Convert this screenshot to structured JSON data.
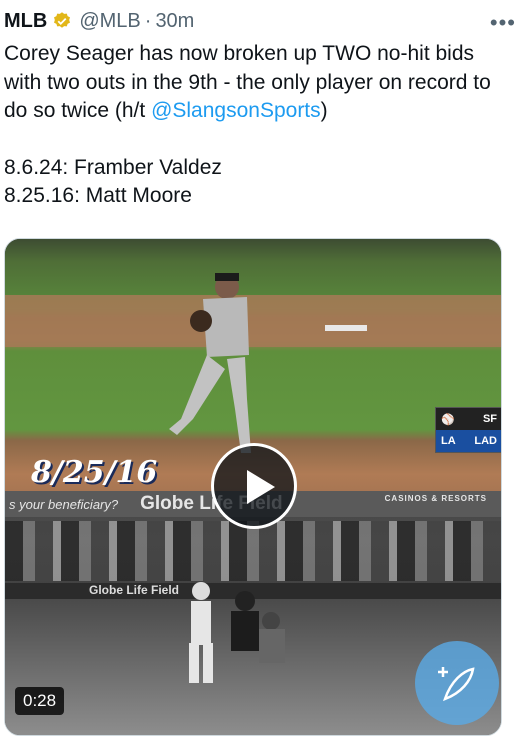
{
  "tweet": {
    "author_name": "MLB",
    "handle": "@MLB",
    "separator": "·",
    "time": "30m",
    "more_icon": "more-icon",
    "verified_icon": "verified-badge-icon",
    "text_line1": "Corey Seager has now broken up TWO no-hit bids with two outs in the 9th - the only player on record to do so twice (h/t ",
    "mention": "@SlangsonSports",
    "text_line1_end": ")",
    "line2": "8.6.24: Framber Valdez",
    "line3": "8.25.16: Matt Moore"
  },
  "media": {
    "date_stamp": "8/25/16",
    "score_bug": {
      "team1": "SF",
      "team2": "LAD"
    },
    "banner_left": "s your beneficiary?",
    "banner_center": "Globe Life Field",
    "banner_right": "CASINOS & RESORTS",
    "wall_sign": "Globe Life Field",
    "duration": "0:28",
    "play_icon": "play-icon",
    "fab_icon": "compose-icon",
    "colors": {
      "accent": "#1d9bf0",
      "verified": "#e2b719"
    }
  }
}
